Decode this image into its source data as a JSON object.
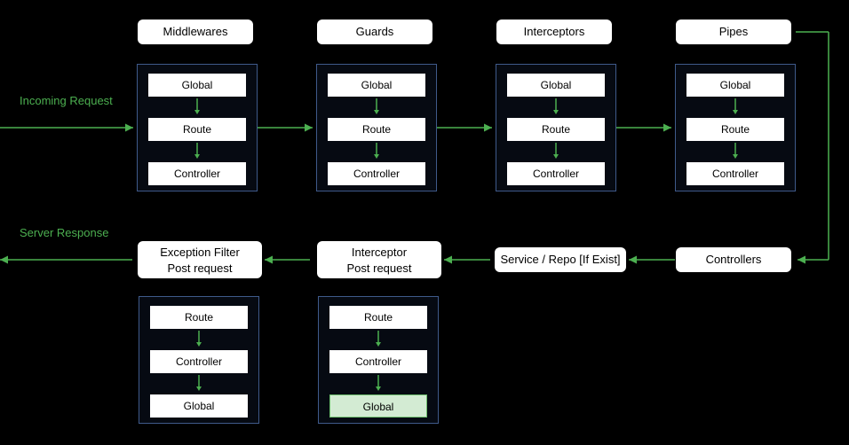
{
  "labels": {
    "incoming": "Incoming Request",
    "response": "Server Response"
  },
  "top_row": [
    {
      "title": "Middlewares",
      "items": [
        "Global",
        "Route",
        "Controller"
      ]
    },
    {
      "title": "Guards",
      "items": [
        "Global",
        "Route",
        "Controller"
      ]
    },
    {
      "title": "Interceptors",
      "items": [
        "Global",
        "Route",
        "Controller"
      ]
    },
    {
      "title": "Pipes",
      "items": [
        "Global",
        "Route",
        "Controller"
      ]
    }
  ],
  "bottom_row": {
    "controllers": "Controllers",
    "service": "Service / Repo [If Exist]",
    "interceptor_post": {
      "title_line1": "Interceptor",
      "title_line2": "Post request",
      "items": [
        "Route",
        "Controller",
        "Global"
      ],
      "highlight_index": 2
    },
    "exception_filter": {
      "title_line1": "Exception Filter",
      "title_line2": "Post request",
      "items": [
        "Route",
        "Controller",
        "Global"
      ]
    }
  }
}
